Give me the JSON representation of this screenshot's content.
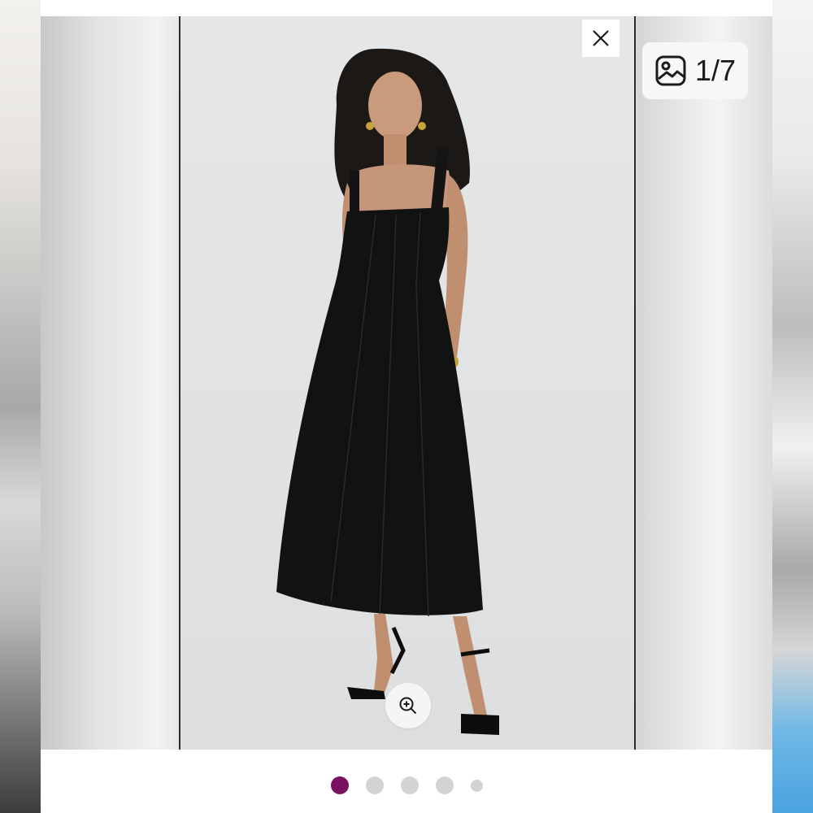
{
  "gallery": {
    "counter": {
      "icon": "image-icon",
      "text": "1/7"
    },
    "close": {
      "icon": "close-icon"
    },
    "zoom": {
      "icon": "zoom-in-icon"
    },
    "pager": {
      "total_dots": 5,
      "active_index": 0
    }
  },
  "colors": {
    "active_dot": "#7a1060",
    "inactive_dot": "#d3d3d3"
  }
}
